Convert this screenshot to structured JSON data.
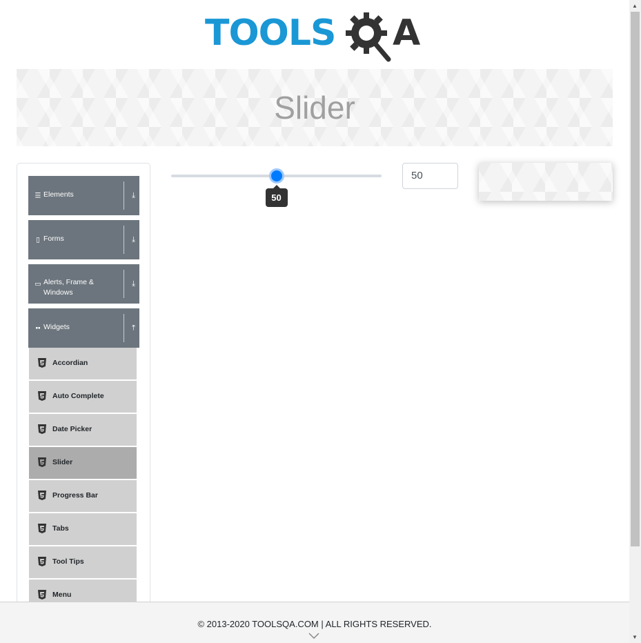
{
  "header": {
    "logo_tools": "TOOLS",
    "logo_a": "A",
    "logo_color": "#1a97d5",
    "logo_dark_color": "#333333"
  },
  "banner": {
    "title": "Slider"
  },
  "sidebar": {
    "groups": [
      {
        "label": "Elements",
        "icon": "hamburger-icon",
        "arrow": "⤓"
      },
      {
        "label": "Forms",
        "icon": "document-icon",
        "arrow": "⤓"
      },
      {
        "label": "Alerts, Frame & Windows",
        "icon": "window-icon",
        "arrow": "⤓"
      },
      {
        "label": "Widgets",
        "icon": "grid-icon",
        "arrow": "⤒"
      }
    ],
    "items": [
      {
        "label": "Accordian",
        "icon": "html5-icon"
      },
      {
        "label": "Auto Complete",
        "icon": "html5-icon"
      },
      {
        "label": "Date Picker",
        "icon": "html5-icon"
      },
      {
        "label": "Slider",
        "icon": "html5-icon",
        "active": true
      },
      {
        "label": "Progress Bar",
        "icon": "html5-icon"
      },
      {
        "label": "Tabs",
        "icon": "html5-icon"
      },
      {
        "label": "Tool Tips",
        "icon": "html5-icon"
      },
      {
        "label": "Menu",
        "icon": "html5-icon"
      }
    ],
    "group_color": "#6c757d",
    "item_color": "#d0d0d0",
    "active_item_color": "#acacac"
  },
  "slider": {
    "min": 0,
    "max": 100,
    "value": 50,
    "tooltip": "50",
    "thumb_color": "#007bff"
  },
  "value_field": {
    "value": "50"
  },
  "footer": {
    "text": "© 2013-2020 TOOLSQA.COM | ALL RIGHTS RESERVED."
  }
}
